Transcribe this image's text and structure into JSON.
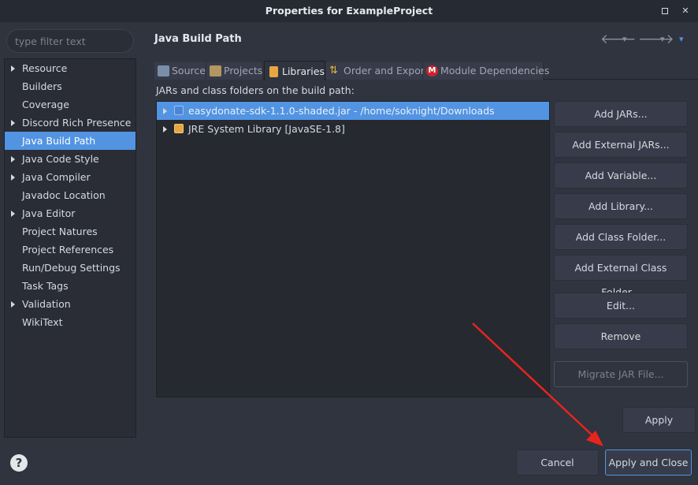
{
  "window": {
    "title": "Properties for ExampleProject",
    "restore_icon": "restore-icon",
    "close_icon": "close-icon"
  },
  "filter": {
    "placeholder": "type filter text",
    "value": ""
  },
  "tree": {
    "items": [
      {
        "label": "Resource",
        "expandable": true,
        "selected": false
      },
      {
        "label": "Builders",
        "expandable": false,
        "selected": false
      },
      {
        "label": "Coverage",
        "expandable": false,
        "selected": false
      },
      {
        "label": "Discord Rich Presence",
        "expandable": true,
        "selected": false
      },
      {
        "label": "Java Build Path",
        "expandable": false,
        "selected": true
      },
      {
        "label": "Java Code Style",
        "expandable": true,
        "selected": false
      },
      {
        "label": "Java Compiler",
        "expandable": true,
        "selected": false
      },
      {
        "label": "Javadoc Location",
        "expandable": false,
        "selected": false
      },
      {
        "label": "Java Editor",
        "expandable": true,
        "selected": false
      },
      {
        "label": "Project Natures",
        "expandable": false,
        "selected": false
      },
      {
        "label": "Project References",
        "expandable": false,
        "selected": false
      },
      {
        "label": "Run/Debug Settings",
        "expandable": false,
        "selected": false
      },
      {
        "label": "Task Tags",
        "expandable": false,
        "selected": false
      },
      {
        "label": "Validation",
        "expandable": true,
        "selected": false
      },
      {
        "label": "WikiText",
        "expandable": false,
        "selected": false
      }
    ]
  },
  "page": {
    "title": "Java Build Path",
    "subtitle": "JARs and class folders on the build path:"
  },
  "nav": {
    "back_icon": "arrow-left-icon",
    "forward_icon": "arrow-right-icon",
    "menu_icon": "chevron-down-icon"
  },
  "tabs": [
    {
      "label": "Source",
      "icon": "source-folder-icon",
      "active": false
    },
    {
      "label": "Projects",
      "icon": "projects-folder-icon",
      "active": false
    },
    {
      "label": "Libraries",
      "icon": "libraries-icon",
      "active": true
    },
    {
      "label": "Order and Export",
      "icon": "order-arrows-icon",
      "active": false
    },
    {
      "label": "Module Dependencies",
      "icon": "module-m-icon",
      "active": false
    }
  ],
  "libraries": [
    {
      "label": "easydonate-sdk-1.1.0-shaded.jar - /home/soknight/Downloads",
      "icon": "jar-icon",
      "selected": true
    },
    {
      "label": "JRE System Library [JavaSE-1.8]",
      "icon": "library-icon",
      "selected": false
    }
  ],
  "buttons": {
    "add_jars": "Add JARs...",
    "add_external_jars": "Add External JARs...",
    "add_variable": "Add Variable...",
    "add_library": "Add Library...",
    "add_class_folder": "Add Class Folder...",
    "add_external_class_folder": "Add External Class Folder...",
    "edit": "Edit...",
    "remove": "Remove",
    "migrate_jar": "Migrate JAR File...",
    "apply": "Apply",
    "cancel": "Cancel",
    "apply_and_close": "Apply and Close"
  },
  "help": {
    "icon": "help-icon",
    "glyph": "?"
  },
  "colors": {
    "accent": "#5294e2",
    "annotation_arrow": "#e8241c"
  }
}
